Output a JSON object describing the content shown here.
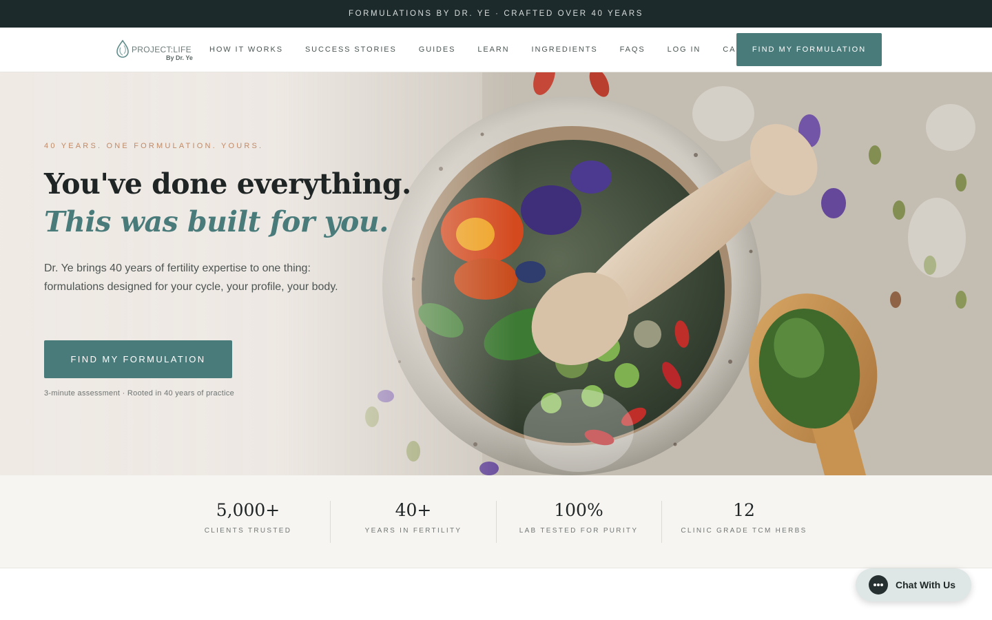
{
  "announcement": {
    "text": "FORMULATIONS BY DR. YE · CRAFTED OVER 40 YEARS"
  },
  "nav": {
    "logo": {
      "main": "PROJECT:LIFE",
      "sub": "By Dr. Ye",
      "icon": "droplet-logo-icon"
    },
    "links": [
      {
        "label": "HOW IT WORKS"
      },
      {
        "label": "SUCCESS STORIES"
      },
      {
        "label": "GUIDES"
      },
      {
        "label": "LEARN"
      },
      {
        "label": "INGREDIENTS"
      },
      {
        "label": "FAQS"
      },
      {
        "label": "LOG IN"
      },
      {
        "label": "CART"
      }
    ],
    "cta_label": "FIND MY FORMULATION"
  },
  "hero": {
    "eyebrow": "40 YEARS. ONE FORMULATION. YOURS.",
    "headline": "You've done everything.",
    "headline_emphasis": "This was built for you.",
    "body": "Dr. Ye brings 40 years of fertility expertise to one thing: formulations designed for your cycle, your profile, your body.",
    "cta_label": "FIND MY FORMULATION",
    "note": "3-minute assessment · Rooted in 40 years of practice",
    "image": "mortar-and-pestle-with-herbs-image"
  },
  "stats": [
    {
      "value": "5,000+",
      "label": "CLIENTS TRUSTED"
    },
    {
      "value": "40+",
      "label": "YEARS IN FERTILITY"
    },
    {
      "value": "100%",
      "label": "LAB TESTED FOR PURITY"
    },
    {
      "value": "12",
      "label": "CLINIC GRADE TCM HERBS"
    }
  ],
  "chat": {
    "label": "Chat With Us",
    "icon": "chat-bubble-icon"
  },
  "colors": {
    "announcement_bg": "#1d2a2b",
    "accent": "#4a7b7b",
    "eyebrow": "#c08a66",
    "stats_bg": "#f7f5f2"
  }
}
